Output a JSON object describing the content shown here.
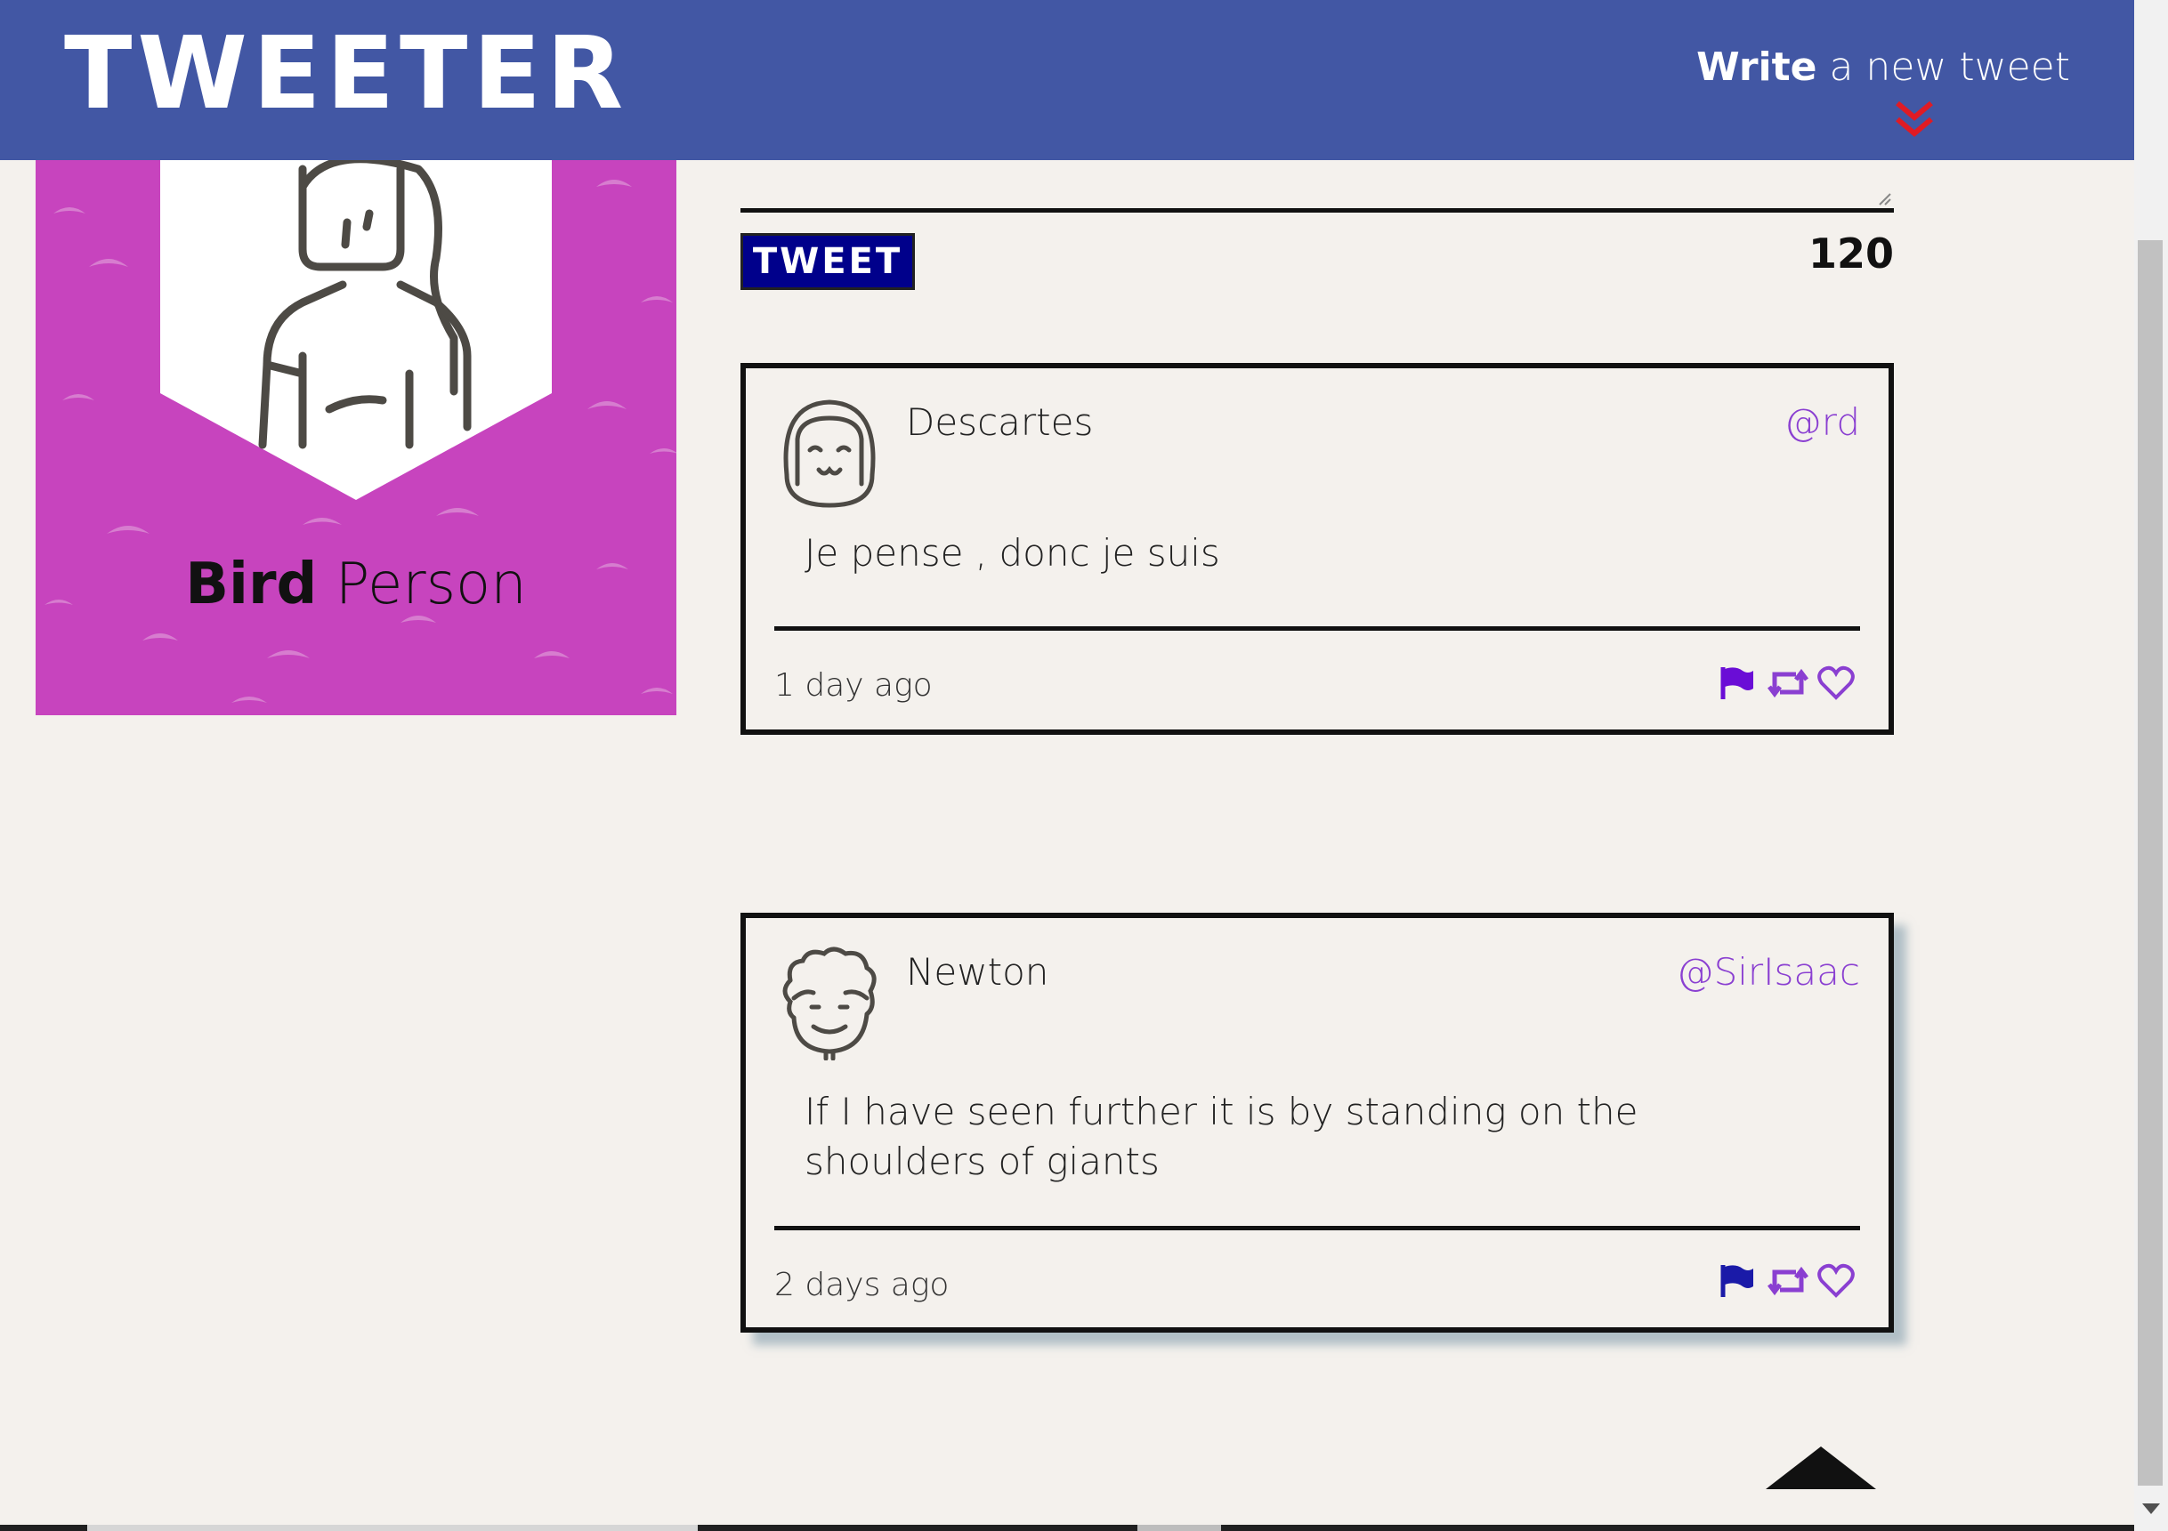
{
  "header": {
    "logo": "TWEETER",
    "compose_bold": "Write",
    "compose_rest": " a new tweet"
  },
  "profile": {
    "first_name": "Bird",
    "last_name": " Person"
  },
  "composer": {
    "button_label": "TWEET",
    "char_count": "120"
  },
  "tweets": [
    {
      "author": "Descartes",
      "handle": "@rd",
      "text": "Je pense , donc je suis",
      "time": "1 day ago"
    },
    {
      "author": "Newton",
      "handle": "@SirIsaac",
      "text": "If I have seen further it is by standing on the shoulders of giants",
      "time": "2 days ago"
    }
  ],
  "colors": {
    "header": "#4257a4",
    "profile_bg": "#c744be",
    "accent": "#8a3fd1",
    "flag_active": "#6a0dd6",
    "flag_default": "#1a1aa8",
    "chevron": "#e01b24"
  },
  "icons": [
    "chevron-double-down-icon",
    "flag-icon",
    "retweet-icon",
    "heart-icon",
    "back-to-top-icon"
  ]
}
